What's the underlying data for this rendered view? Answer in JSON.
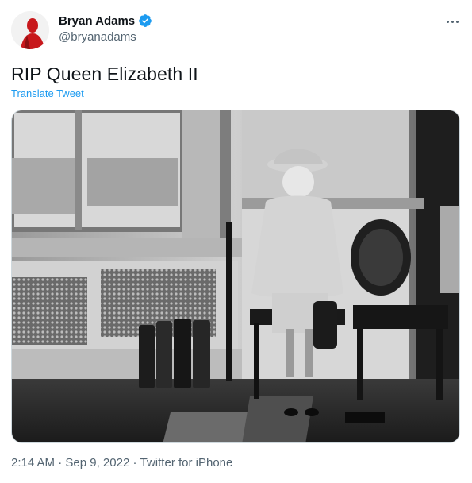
{
  "author": {
    "display_name": "Bryan Adams",
    "handle": "@bryanadams",
    "verified": true,
    "avatar_icon": "profile-photo"
  },
  "tweet": {
    "text": "RIP Queen Elizabeth II",
    "translate_label": "Translate Tweet",
    "media_alt": "black-and-white-photo"
  },
  "meta": {
    "time": "2:14 AM",
    "separator": " · ",
    "date": "Sep 9, 2022",
    "source": "Twitter for iPhone"
  },
  "colors": {
    "link": "#1d9bf0",
    "secondary_text": "#536471",
    "primary_text": "#0f1419",
    "verified_badge": "#1d9bf0"
  }
}
